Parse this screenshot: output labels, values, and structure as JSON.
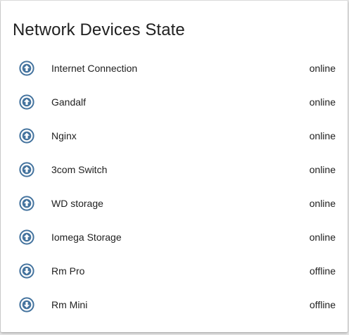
{
  "card": {
    "title": "Network Devices State"
  },
  "icon_color": "#44739e",
  "devices": [
    {
      "name": "Internet Connection",
      "state": "online",
      "icon": "arrow-up-circle-icon"
    },
    {
      "name": "Gandalf",
      "state": "online",
      "icon": "arrow-up-circle-icon"
    },
    {
      "name": "Nginx",
      "state": "online",
      "icon": "arrow-up-circle-icon"
    },
    {
      "name": "3com Switch",
      "state": "online",
      "icon": "arrow-up-circle-icon"
    },
    {
      "name": "WD storage",
      "state": "online",
      "icon": "arrow-up-circle-icon"
    },
    {
      "name": "Iomega Storage",
      "state": "online",
      "icon": "arrow-up-circle-icon"
    },
    {
      "name": "Rm Pro",
      "state": "offline",
      "icon": "arrow-down-circle-icon"
    },
    {
      "name": "Rm Mini",
      "state": "offline",
      "icon": "arrow-down-circle-icon"
    }
  ]
}
